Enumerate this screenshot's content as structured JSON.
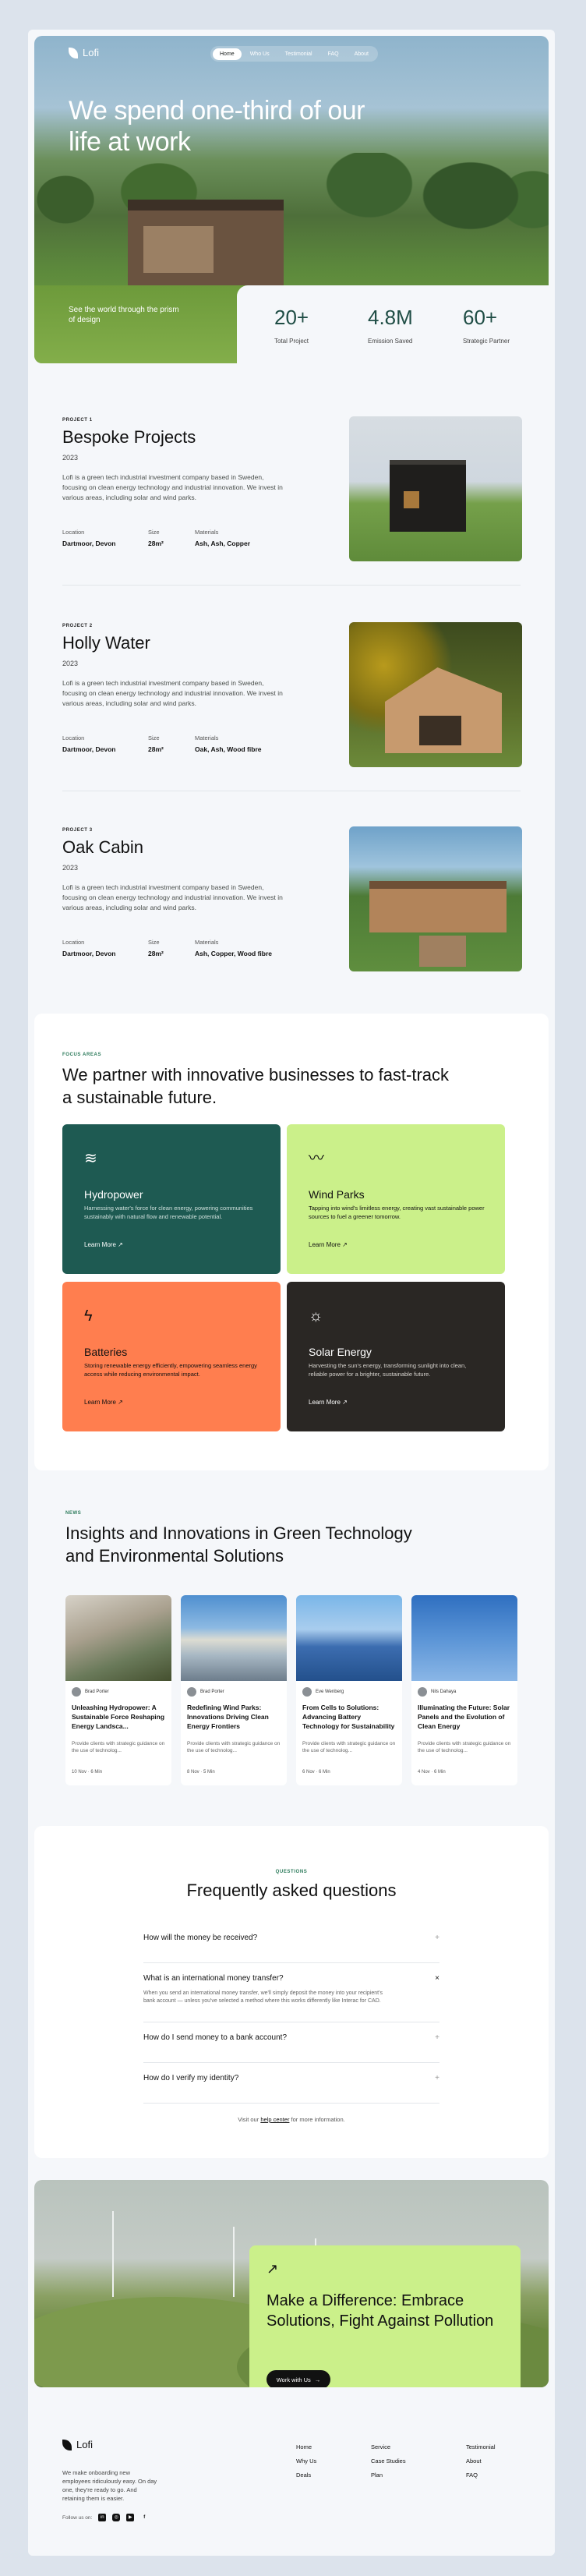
{
  "brand": {
    "name": "Lofi"
  },
  "nav": {
    "items": [
      "Home",
      "Who Us",
      "Testimonial",
      "FAQ",
      "About"
    ],
    "active": "Home"
  },
  "hero": {
    "headline": "We spend one-third of our life at work",
    "tagline": "See the world through the prism of design",
    "stats": [
      {
        "value": "20+",
        "label": "Total Project"
      },
      {
        "value": "4.8M",
        "label": "Emission Saved"
      },
      {
        "value": "60+",
        "label": "Strategic Partner"
      }
    ]
  },
  "projects": [
    {
      "label": "PROJECT 1",
      "title": "Bespoke Projects",
      "year": "2023",
      "description": "Lofi is a green tech industrial investment company based in Sweden, focusing on clean energy technology and industrial innovation. We invest in various areas, including solar and wind parks.",
      "location_label": "Location",
      "location": "Dartmoor, Devon",
      "size_label": "Size",
      "size": "28m²",
      "materials_label": "Materials",
      "materials": "Ash, Ash, Copper"
    },
    {
      "label": "PROJECT 2",
      "title": "Holly Water",
      "year": "2023",
      "description": "Lofi is a green tech industrial investment company based in Sweden, focusing on clean energy technology and industrial innovation. We invest in various areas, including solar and wind parks.",
      "location_label": "Location",
      "location": "Dartmoor, Devon",
      "size_label": "Size",
      "size": "28m²",
      "materials_label": "Materials",
      "materials": "Oak, Ash, Wood fibre"
    },
    {
      "label": "PROJECT 3",
      "title": "Oak Cabin",
      "year": "2023",
      "description": "Lofi is a green tech industrial investment company based in Sweden, focusing on clean energy technology and industrial innovation. We invest in various areas, including solar and wind parks.",
      "location_label": "Location",
      "location": "Dartmoor, Devon",
      "size_label": "Size",
      "size": "28m²",
      "materials_label": "Materials",
      "materials": "Ash, Copper, Wood fibre"
    }
  ],
  "focus": {
    "label": "FOCUS AREAS",
    "heading": "We partner with innovative businesses to fast-track a sustainable future.",
    "cards": [
      {
        "title": "Hydropower",
        "icon": "water-waves-icon",
        "text": "Harnessing water's force for clean energy, powering communities sustainably with natural flow and renewable potential.",
        "link": "Learn More",
        "bg": "#1e5a52",
        "fg": "#ffffff"
      },
      {
        "title": "Wind Parks",
        "icon": "wind-icon",
        "text": "Tapping into wind's limitless energy, creating vast sustainable power sources to fuel a greener tomorrow.",
        "link": "Learn More",
        "bg": "#cbf08a",
        "fg": "#111111"
      },
      {
        "title": "Batteries",
        "icon": "lightning-icon",
        "text": "Storing renewable energy efficiently, empowering seamless energy access while reducing environmental impact.",
        "link": "Learn More",
        "bg": "#ff7e4f",
        "fg": "#111111"
      },
      {
        "title": "Solar Energy",
        "icon": "sunrise-icon",
        "text": "Harvesting the sun's energy, transforming sunlight into clean, reliable power for a brighter, sustainable future.",
        "link": "Learn More",
        "bg": "#2a2724",
        "fg": "#ffffff"
      }
    ]
  },
  "news": {
    "label": "NEWS",
    "heading": "Insights and Innovations in Green Technology and Environmental Solutions",
    "articles": [
      {
        "author": "Brad Porter",
        "title": "Unleashing Hydropower: A Sustainable Force Reshaping Energy Landsca...",
        "excerpt": "Provide clients with strategic guidance on the use of technolog...",
        "date": "10 Nov",
        "read": "6 Min"
      },
      {
        "author": "Brad Porter",
        "title": "Redefining Wind Parks: Innovations Driving Clean Energy Frontiers",
        "excerpt": "Provide clients with strategic guidance on the use of technolog...",
        "date": "8 Nov",
        "read": "5 Min"
      },
      {
        "author": "Eve Wenberg",
        "title": "From Cells to Solutions: Advancing Battery Technology for Sustainability",
        "excerpt": "Provide clients with strategic guidance on the use of technolog...",
        "date": "6 Nov",
        "read": "6 Min"
      },
      {
        "author": "Nils Dahaya",
        "title": "Illuminating the Future: Solar Panels and the Evolution of Clean Energy",
        "excerpt": "Provide clients with strategic guidance on the use of technolog...",
        "date": "4 Nov",
        "read": "6 Min"
      }
    ]
  },
  "faq": {
    "label": "QUESTIONS",
    "heading": "Frequently asked questions",
    "items": [
      {
        "q": "How will the money be received?",
        "a": "",
        "open": false
      },
      {
        "q": "What is an international money transfer?",
        "a": "When you send an international money transfer, we'll simply deposit the money into your recipient's bank account — unless you've selected a method where this works differently like Interac for CAD.",
        "open": true
      },
      {
        "q": "How do I send money to a bank account?",
        "a": "",
        "open": false
      },
      {
        "q": "How do I verify my identity?",
        "a": "",
        "open": false
      }
    ],
    "help_prefix": "Visit our",
    "help_link": "help center",
    "help_suffix": "for more information."
  },
  "cta": {
    "heading": "Make a Difference: Embrace Solutions, Fight Against Pollution",
    "button": "Work with Us"
  },
  "footer": {
    "description": "We make onboarding new employees ridiculously easy. On day one, they're ready to go. And retaining them is easier.",
    "follow": "Follow us on:",
    "social": [
      "linkedin-icon",
      "instagram-icon",
      "youtube-icon",
      "facebook-icon"
    ],
    "col1": [
      "Home",
      "Why Us",
      "Deals"
    ],
    "col2": [
      "Service",
      "Case Studies",
      "Plan"
    ],
    "col3": [
      "Testimonial",
      "About",
      "FAQ"
    ]
  }
}
